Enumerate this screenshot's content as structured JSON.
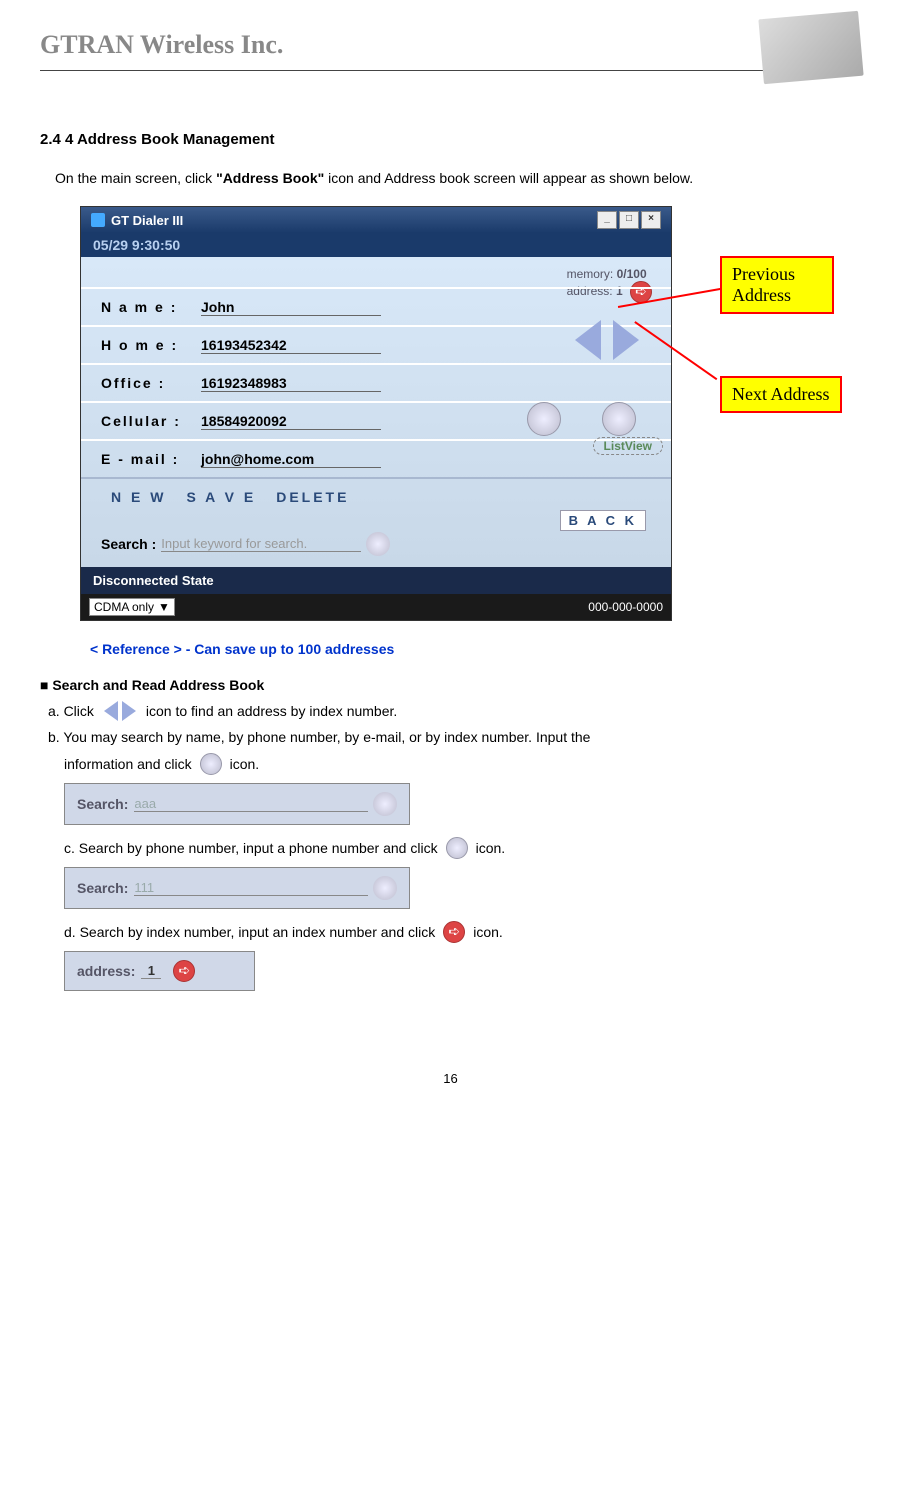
{
  "header": {
    "company": "GTRAN Wireless Inc."
  },
  "section": {
    "heading": "2.4 4 Address Book Management",
    "intro_pre": "On the main screen, click ",
    "intro_bold": "\"Address Book\"",
    "intro_post": " icon and Address book screen will appear as shown below."
  },
  "app": {
    "title": "GT Dialer III",
    "datetime": "05/29    9:30:50",
    "memory_label": "memory:",
    "memory_value": "0/100",
    "address_label": "address:",
    "address_value": "1",
    "fields": {
      "name": {
        "label": "N a m e :",
        "value": "John"
      },
      "home": {
        "label": "H o m e :",
        "value": "16193452342"
      },
      "office": {
        "label": "Office    :",
        "value": "16192348983"
      },
      "cellular": {
        "label": "Cellular :",
        "value": "18584920092"
      },
      "email": {
        "label": "E - mail  :",
        "value": "john@home.com"
      }
    },
    "buttons": {
      "new": "N E W",
      "save": "S A V E",
      "delete": "DELETE",
      "back": "B A C K"
    },
    "listview": "ListView",
    "search": {
      "label": "Search :",
      "placeholder": "Input keyword for search."
    },
    "status": "Disconnected State",
    "mode": "CDMA only",
    "phone": "000-000-0000"
  },
  "callouts": {
    "previous": "Previous Address",
    "next": "Next Address"
  },
  "reference": "< Reference > - Can save up to 100 addresses",
  "search_section": {
    "title": "■ Search and Read Address Book",
    "a_pre": "a.    Click",
    "a_post": "icon to find an address by index number.",
    "b_pre": "b.    You may search by name, by phone number, by e-mail, or by index number. Input the",
    "b_line2_pre": "information and click",
    "b_line2_post": "icon.",
    "c_pre": "c.    Search by phone number, input a phone number and click",
    "c_post": "icon.",
    "d_pre": "d.    Search by index number, input an index number and click",
    "d_post": "icon."
  },
  "mini": {
    "search1": {
      "label": "Search:",
      "value": "aaa"
    },
    "search2": {
      "label": "Search:",
      "value": "111"
    },
    "address": {
      "label": "address:",
      "value": "1"
    }
  },
  "page_number": "16"
}
